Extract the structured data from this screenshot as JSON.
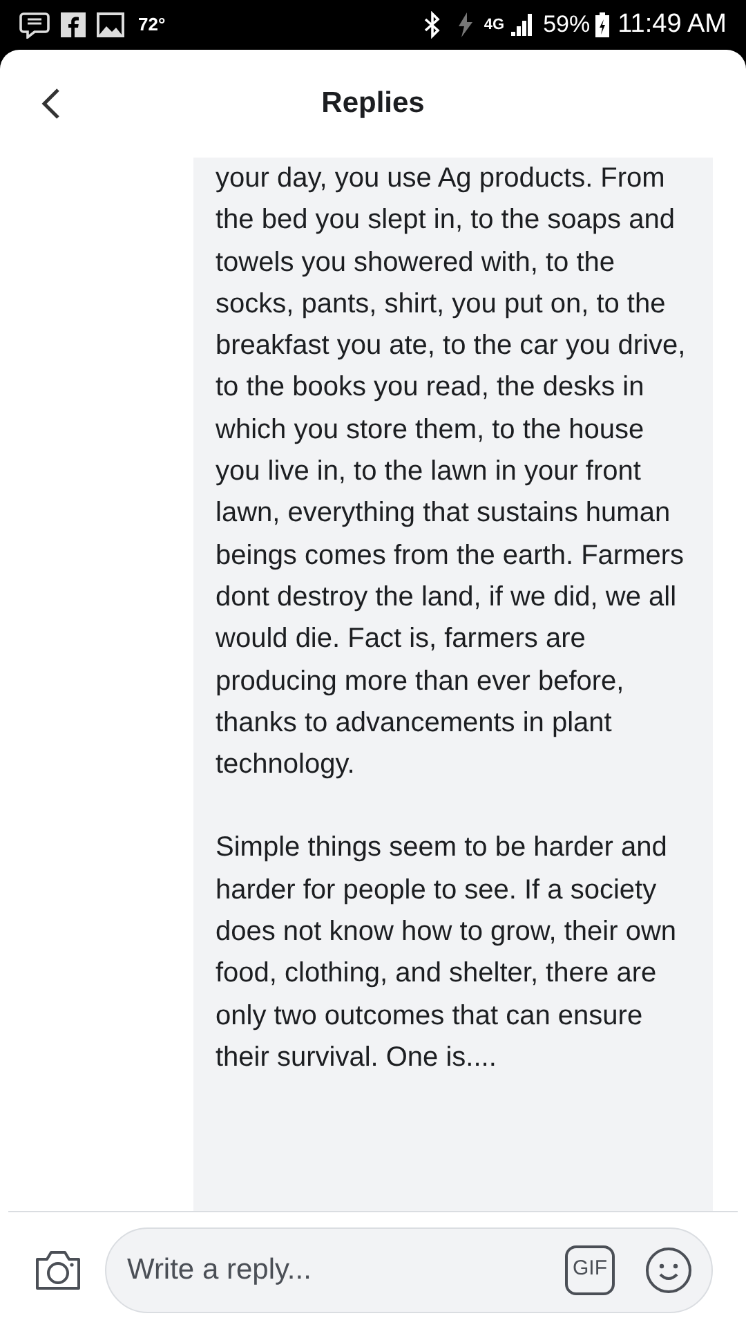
{
  "status_bar": {
    "temperature": "72°",
    "network": "4G",
    "battery": "59%",
    "time": "11:49 AM"
  },
  "header": {
    "title": "Replies"
  },
  "reply": {
    "paragraphs": [
      "your day, you use Ag products. From the bed you slept in, to the soaps and towels you showered with, to the socks, pants, shirt, you put on, to the breakfast you ate, to the car you drive, to the books you read, the desks in which you store them, to the house you live in, to the lawn in your front lawn, everything that sustains human beings comes from the earth. Farmers dont destroy the land, if we did, we all would die. Fact is, farmers are producing more than ever before, thanks to advancements in plant technology.",
      "Simple things seem to be harder and harder for people to see. If a society does not know how to grow, their own food, clothing, and shelter, there are only two outcomes that can ensure their survival. One is...."
    ]
  },
  "composer": {
    "placeholder": "Write a reply...",
    "gif_label": "GIF"
  }
}
